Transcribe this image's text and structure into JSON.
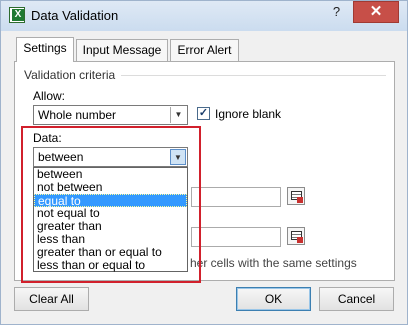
{
  "window": {
    "title": "Data Validation",
    "help": "?",
    "close": "✕"
  },
  "tabs": [
    {
      "label": "Settings"
    },
    {
      "label": "Input Message"
    },
    {
      "label": "Error Alert"
    }
  ],
  "settings": {
    "group_title": "Validation criteria",
    "allow_label": "Allow:",
    "allow_value": "Whole number",
    "ignore_blank_label": "Ignore blank",
    "ignore_blank_checked": "✓",
    "data_label": "Data:",
    "data_value": "between",
    "data_options": [
      "between",
      "not between",
      "equal to",
      "not equal to",
      "greater than",
      "less than",
      "greater than or equal to",
      "less than or equal to"
    ],
    "selected_option_index": 2,
    "apply_text": "her cells with the same settings"
  },
  "buttons": {
    "clear_all": "Clear All",
    "ok": "OK",
    "cancel": "Cancel"
  },
  "colors": {
    "highlight": "#d1202c",
    "selection": "#3399ff",
    "close": "#c74f48"
  },
  "icons": {
    "app": "excel-icon",
    "picker": "range-picker-icon"
  }
}
